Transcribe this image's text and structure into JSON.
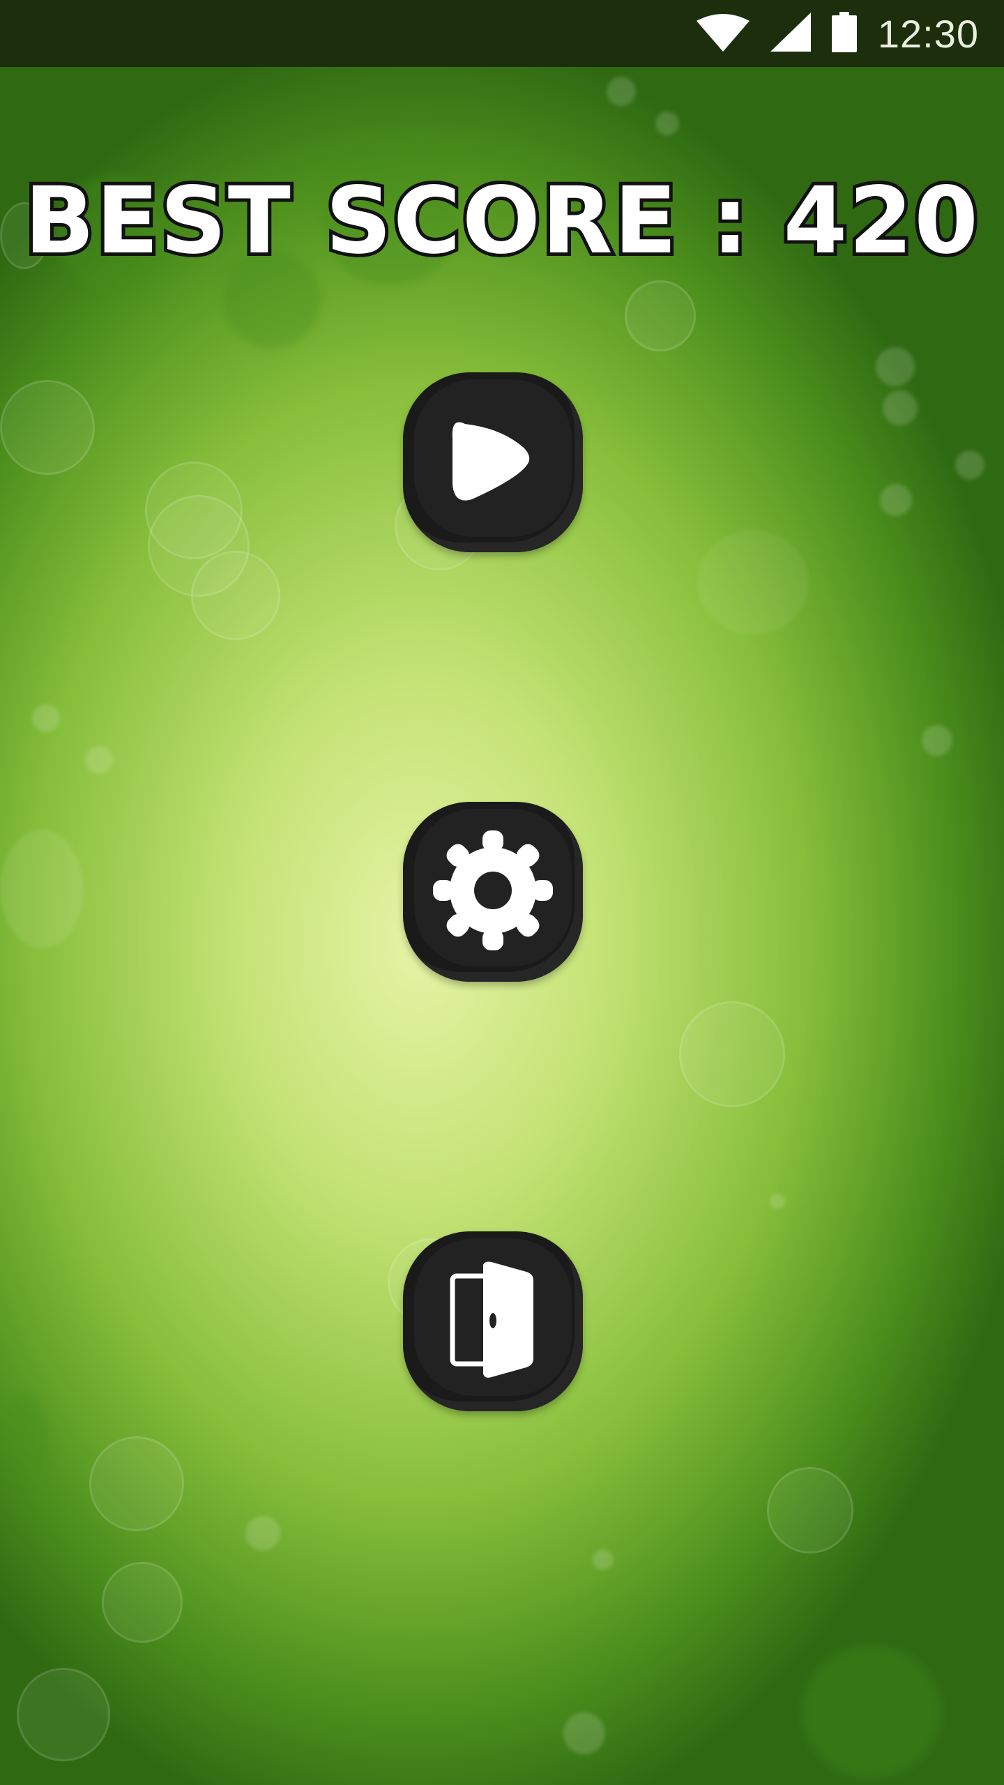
{
  "status_bar": {
    "time": "12:30",
    "icons": [
      "wifi-icon",
      "cellular-signal-icon",
      "battery-icon"
    ],
    "background": "#1c2e0b"
  },
  "best_score": {
    "label": "BEST SCORE : 420",
    "value": 420
  },
  "menu": {
    "buttons": [
      {
        "action": "play",
        "icon": "play-icon"
      },
      {
        "action": "settings",
        "icon": "gear-icon"
      },
      {
        "action": "exit",
        "icon": "door-exit-icon"
      }
    ],
    "button_color": "#1a1a1a",
    "icon_color": "#ffffff"
  },
  "background": {
    "center_color": "#e6f4a6",
    "edge_color": "#2f6a12"
  }
}
